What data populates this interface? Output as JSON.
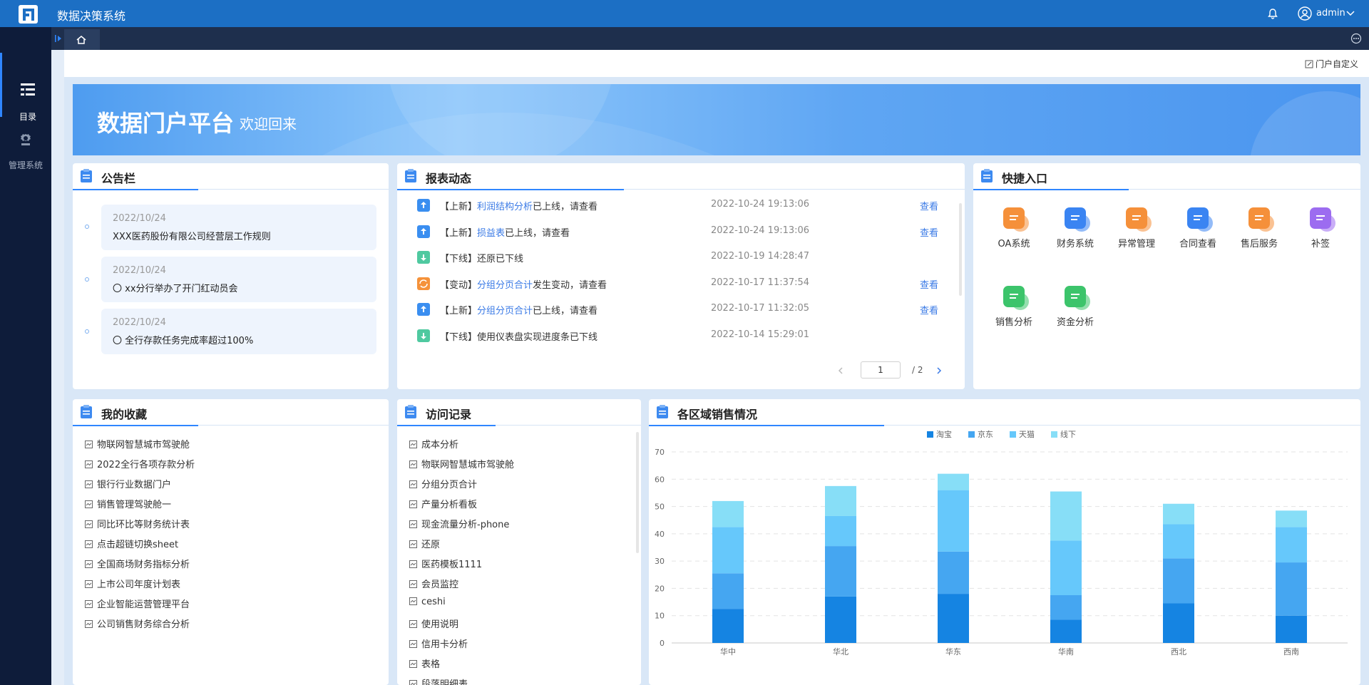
{
  "app": {
    "title": "数据决策系统",
    "user": "admin"
  },
  "nav": [
    {
      "label": "目录",
      "icon": "catalog-icon",
      "active": true
    },
    {
      "label": "管理系统",
      "icon": "gear-icon",
      "active": false
    }
  ],
  "portal": {
    "customize_label": "门户自定义"
  },
  "banner": {
    "title": "数据门户平台",
    "subtitle": "欢迎回来"
  },
  "announcements": {
    "title": "公告栏",
    "items": [
      {
        "date": "2022/10/24",
        "text": "XXX医药股份有限公司经营层工作规则"
      },
      {
        "date": "2022/10/24",
        "text": "〇 xx分行举办了开门红动员会"
      },
      {
        "date": "2022/10/24",
        "text": "〇 全行存款任务完成率超过100%"
      }
    ]
  },
  "reports": {
    "title": "报表动态",
    "items": [
      {
        "tag": "【上新】",
        "link": "利润结构分析",
        "suffix": "已上线，请查看",
        "time": "2022-10-24 19:13:06",
        "action": "查看",
        "kind": "new"
      },
      {
        "tag": "【上新】",
        "link": "损益表",
        "suffix": "已上线，请查看",
        "time": "2022-10-24 19:13:06",
        "action": "查看",
        "kind": "new"
      },
      {
        "tag": "【下线】",
        "link": "",
        "suffix": "还原已下线",
        "time": "2022-10-19 14:28:47",
        "action": "",
        "kind": "offline"
      },
      {
        "tag": "【变动】",
        "link": "分组分页合计",
        "suffix": "发生变动，请查看",
        "time": "2022-10-17 11:37:54",
        "action": "查看",
        "kind": "change"
      },
      {
        "tag": "【上新】",
        "link": "分组分页合计",
        "suffix": "已上线，请查看",
        "time": "2022-10-17 11:32:05",
        "action": "查看",
        "kind": "new"
      },
      {
        "tag": "【下线】",
        "link": "",
        "suffix": "使用仪表盘实现进度条已下线",
        "time": "2022-10-14 15:29:01",
        "action": "",
        "kind": "offline"
      }
    ],
    "pager": {
      "current": "1",
      "total": "/ 2"
    }
  },
  "quick": {
    "title": "快捷入口",
    "items": [
      {
        "label": "OA系统",
        "color": "#f5903a",
        "icon": "oa-icon"
      },
      {
        "label": "财务系统",
        "color": "#3a84f2",
        "icon": "finance-icon"
      },
      {
        "label": "异常管理",
        "color": "#f5903a",
        "icon": "exception-icon"
      },
      {
        "label": "合同查看",
        "color": "#3a84f2",
        "icon": "contract-icon"
      },
      {
        "label": "售后服务",
        "color": "#f5903a",
        "icon": "service-icon"
      },
      {
        "label": "补签",
        "color": "#9c6cf0",
        "icon": "resign-icon"
      },
      {
        "label": "销售分析",
        "color": "#3cc46b",
        "icon": "sales-icon"
      },
      {
        "label": "资金分析",
        "color": "#3cc46b",
        "icon": "fund-icon"
      }
    ]
  },
  "favorites": {
    "title": "我的收藏",
    "items": [
      "物联网智慧城市驾驶舱",
      "2022全行各项存款分析",
      "银行行业数据门户",
      "销售管理驾驶舱一",
      "同比环比等财务统计表",
      "点击超链切换sheet",
      "全国商场财务指标分析",
      "上市公司年度计划表",
      "企业智能运营管理平台",
      "公司销售财务综合分析"
    ]
  },
  "visits": {
    "title": "访问记录",
    "items": [
      "成本分析",
      "物联网智慧城市驾驶舱",
      "分组分页合计",
      "产量分析看板",
      "现金流量分析-phone",
      "还原",
      "医药模板1111",
      "会员监控",
      "ceshi",
      "使用说明",
      "信用卡分析",
      "表格",
      "段落明细表"
    ]
  },
  "sales_panel": {
    "title": "各区域销售情况"
  },
  "colors": {
    "taobao": "#1584e2",
    "jingdong": "#45a6f1",
    "tianmao": "#66c8fb",
    "offline": "#87def7"
  },
  "chart_data": {
    "type": "bar",
    "stacked": true,
    "title": "",
    "categories": [
      "华中",
      "华北",
      "华东",
      "华南",
      "西北",
      "西南"
    ],
    "series": [
      {
        "name": "淘宝",
        "values": [
          12.5,
          17,
          18,
          8.5,
          14.5,
          10
        ]
      },
      {
        "name": "京东",
        "values": [
          13,
          18.5,
          15.5,
          9,
          16.5,
          19.5
        ]
      },
      {
        "name": "天猫",
        "values": [
          17,
          11,
          22.5,
          20,
          12.5,
          13
        ]
      },
      {
        "name": "线下",
        "values": [
          9.5,
          11,
          6,
          18,
          7.5,
          6
        ]
      }
    ],
    "ylim": [
      0,
      70
    ],
    "yticks": [
      0,
      10,
      20,
      30,
      40,
      50,
      60,
      70
    ],
    "grid": true,
    "legend": "top-center"
  }
}
